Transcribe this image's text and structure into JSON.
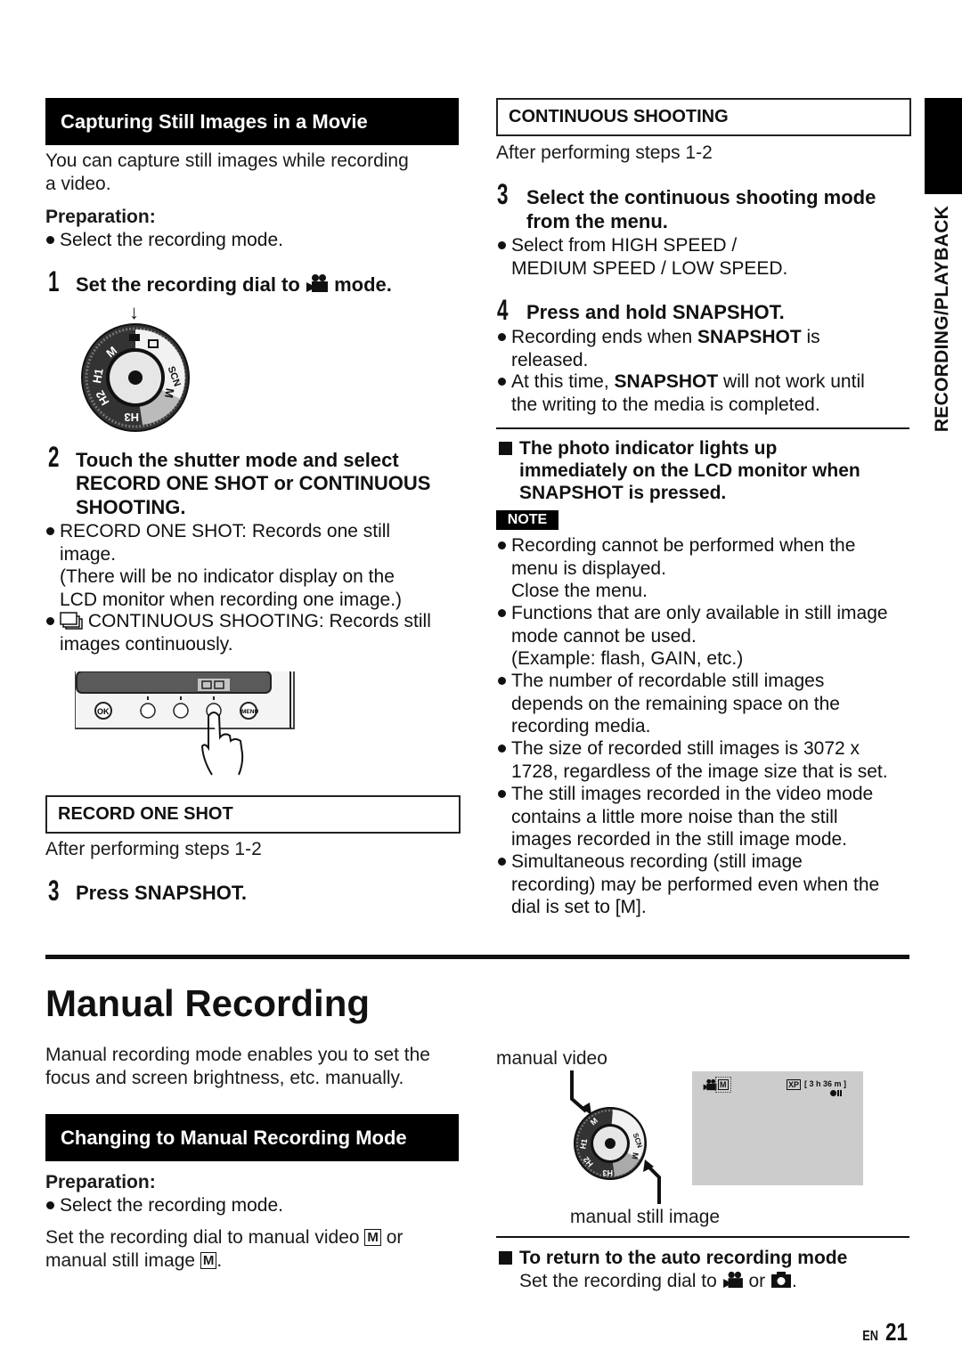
{
  "side_tab": {
    "label": "RECORDING/PLAYBACK"
  },
  "left": {
    "section_title": "Capturing Still Images in a Movie",
    "intro": [
      "You can capture still images while recording",
      "a video."
    ],
    "preparation_label": "Preparation:",
    "preparation_item": "Select the recording mode.",
    "step1": {
      "num": "1",
      "text_before": "Set the recording dial to",
      "text_after": "mode."
    },
    "dial": {
      "labels": [
        "M",
        "H1",
        "H2",
        "H3",
        "SCN",
        "M"
      ]
    },
    "step2": {
      "num": "2",
      "lines": [
        "Touch the shutter mode and select",
        "RECORD ONE SHOT or CONTINUOUS",
        "SHOOTING."
      ]
    },
    "step2_bullets": [
      {
        "lines": [
          "RECORD ONE SHOT: Records one still",
          "image.",
          "(There will be no indicator display on the",
          "LCD monitor when recording one image.)"
        ]
      },
      {
        "lines": [
          "CONTINUOUS SHOOTING: Records still",
          "images continuously."
        ]
      }
    ],
    "camera_panel": {
      "buttons": [
        "OK",
        "",
        "",
        "",
        "MENU"
      ]
    },
    "record_one_shot": {
      "title": "RECORD ONE SHOT",
      "after": "After performing steps 1-2",
      "step3": {
        "num": "3",
        "text": "Press SNAPSHOT."
      }
    }
  },
  "right": {
    "continuous": {
      "title": "CONTINUOUS SHOOTING",
      "after": "After performing steps 1-2",
      "step3": {
        "num": "3",
        "lines": [
          "Select the continuous shooting mode",
          "from the menu."
        ]
      },
      "step3_bullet": [
        "Select from HIGH SPEED /",
        "MEDIUM SPEED / LOW SPEED."
      ],
      "step4": {
        "num": "4",
        "text": "Press and hold SNAPSHOT."
      },
      "step4_bullets": [
        {
          "pre": "Recording ends when ",
          "bold": "SNAPSHOT",
          "post": " is",
          "line2": "released."
        },
        {
          "pre": "At this time, ",
          "bold": "SNAPSHOT",
          "post": " will not work until",
          "line2": "the writing to the media is completed."
        }
      ]
    },
    "photo_indicator": [
      "The photo indicator lights up",
      "immediately on the LCD monitor when",
      "SNAPSHOT is pressed."
    ],
    "note_label": "NOTE",
    "notes": [
      {
        "lines": [
          "Recording cannot be performed when the",
          "menu is displayed.",
          "Close the menu."
        ]
      },
      {
        "lines": [
          "Functions that are only available in still image",
          "mode cannot be used.",
          "(Example: flash, GAIN, etc.)"
        ]
      },
      {
        "lines": [
          "The number of recordable still images",
          "depends on the remaining space on the",
          "recording media."
        ]
      },
      {
        "lines": [
          "The size of recorded still images is 3072 x",
          "1728, regardless of the image size that is set."
        ]
      },
      {
        "lines": [
          "The still images recorded in the video mode",
          "contains a little more noise than the still",
          "images recorded in the still image mode."
        ]
      },
      {
        "lines": [
          "Simultaneous recording (still image",
          "recording) may be performed even when the",
          "dial is set to [M]."
        ]
      }
    ]
  },
  "manual": {
    "title": "Manual Recording",
    "intro": [
      "Manual recording mode enables you to set the",
      "focus and screen brightness, etc. manually."
    ],
    "section_title": "Changing to Manual Recording Mode",
    "preparation_label": "Preparation:",
    "preparation_item": "Select the recording mode.",
    "instruction": {
      "line1_before": "Set the recording dial to manual video",
      "m": "M",
      "line1_after": "or",
      "line2_before": "manual still image",
      "line2_after": "."
    },
    "label_manual_video": "manual video",
    "label_manual_still": "manual still image",
    "lcd": {
      "mode": "M",
      "quality": "XP",
      "remaining": "[ 3 h 36 m ]"
    },
    "return": {
      "title": "To return to the auto recording mode",
      "text_before": "Set the recording dial to",
      "text_mid": "or",
      "text_after": "."
    }
  },
  "footer": {
    "lang": "EN",
    "page": "21"
  }
}
